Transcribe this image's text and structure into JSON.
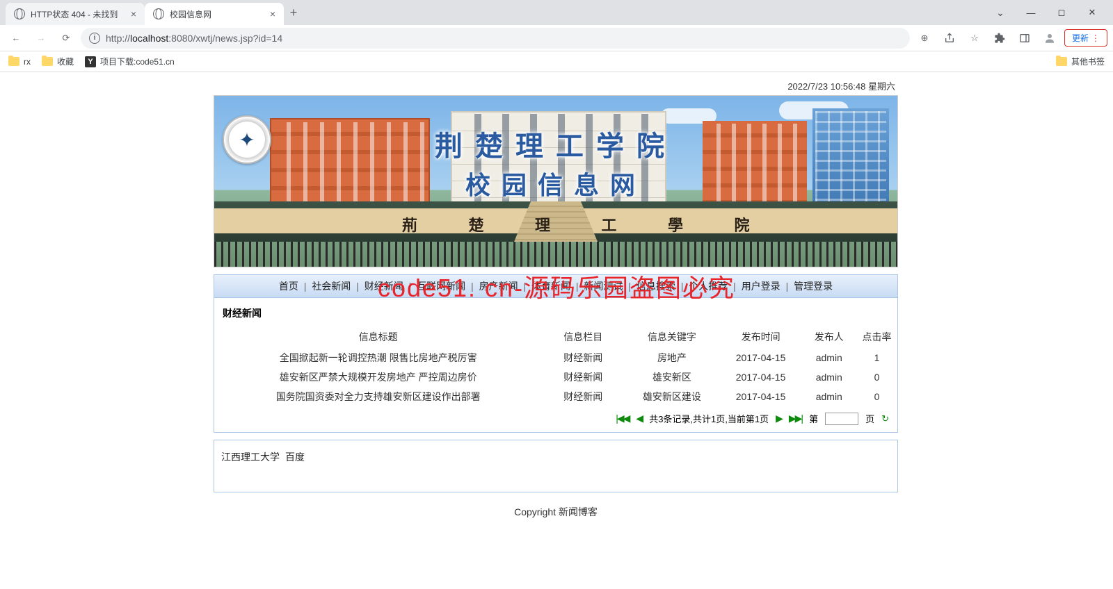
{
  "browser": {
    "tabs": [
      {
        "title": "HTTP状态 404 - 未找到",
        "active": false
      },
      {
        "title": "校园信息网",
        "active": true
      }
    ],
    "url_prefix": "http://",
    "url_host": "localhost",
    "url_path": ":8080/xwtj/news.jsp?id=14",
    "update_label": "更新",
    "bookmarks": [
      {
        "label": "rx",
        "icon": "folder"
      },
      {
        "label": "收藏",
        "icon": "folder"
      },
      {
        "label": "项目下载:code51.cn",
        "icon": "y"
      }
    ],
    "other_bookmarks": "其他书签"
  },
  "datetime": "2022/7/23 10:56:48  星期六",
  "banner": {
    "title_main": "荆楚理工学院",
    "title_sub": "校园信息网",
    "wall_text": "荊 楚 理 工 學 院"
  },
  "nav": [
    "首页",
    "社会新闻",
    "财经新闻",
    "互联网新闻",
    "房产新闻",
    "体育新闻",
    "新闻测试",
    "信息搜索",
    "个人推荐",
    "用户登录",
    "管理登录"
  ],
  "section_title": "财经新闻",
  "columns": [
    "信息标题",
    "信息栏目",
    "信息关键字",
    "发布时间",
    "发布人",
    "点击率"
  ],
  "rows": [
    {
      "title": "全国掀起新一轮调控热潮 限售比房地产税厉害",
      "cat": "财经新闻",
      "kw": "房地产",
      "date": "2017-04-15",
      "pub": "admin",
      "clicks": "1"
    },
    {
      "title": "雄安新区严禁大规模开发房地产 严控周边房价",
      "cat": "财经新闻",
      "kw": "雄安新区",
      "date": "2017-04-15",
      "pub": "admin",
      "clicks": "0"
    },
    {
      "title": "国务院国资委对全力支持雄安新区建设作出部署",
      "cat": "财经新闻",
      "kw": "雄安新区建设",
      "date": "2017-04-15",
      "pub": "admin",
      "clicks": "0"
    }
  ],
  "pager": {
    "summary": "共3条记录,共计1页,当前第1页",
    "di": "第",
    "ye": "页"
  },
  "links": [
    "江西理工大学",
    "百度"
  ],
  "footer": "Copyright 新闻博客",
  "watermark": "code51. cn-源码乐园盗图必究"
}
